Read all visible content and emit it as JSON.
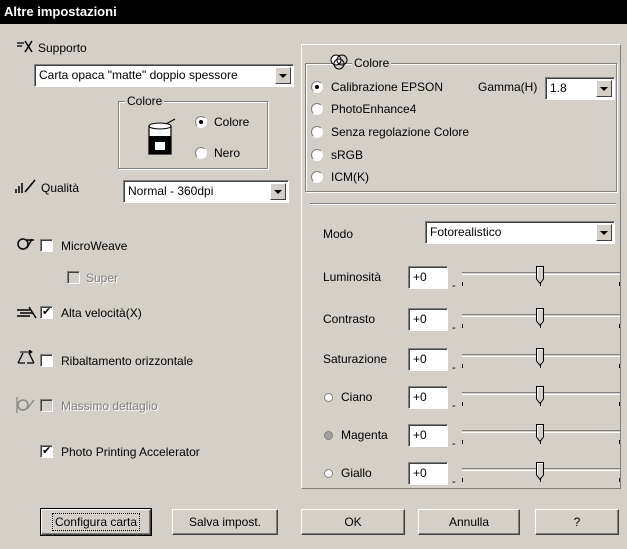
{
  "window": {
    "title": "Altre impostazioni"
  },
  "supporto": {
    "label": "Supporto",
    "value": "Carta opaca \"matte\" doppio spessore"
  },
  "colore_group": {
    "title": "Colore",
    "options": [
      {
        "label": "Colore",
        "selected": true
      },
      {
        "label": "Nero",
        "selected": false
      }
    ]
  },
  "qualita": {
    "label": "Qualità",
    "value": "Normal - 360dpi"
  },
  "checks": {
    "microweave": {
      "label": "MicroWeave",
      "checked": false
    },
    "super": {
      "label": "Super",
      "checked": false,
      "disabled": true
    },
    "alta_velocita": {
      "label": "Alta velocità(X)",
      "checked": true
    },
    "ribaltamento": {
      "label": "Ribaltamento orizzontale",
      "checked": false
    },
    "massimo": {
      "label": "Massimo dettaglio",
      "checked": false,
      "disabled": true
    },
    "photo_printing": {
      "label": "Photo Printing Accelerator",
      "checked": true
    }
  },
  "color_panel": {
    "title": "Colore",
    "options": [
      {
        "label": "Calibrazione EPSON",
        "selected": true
      },
      {
        "label": "PhotoEnhance4",
        "selected": false
      },
      {
        "label": "Senza regolazione Colore",
        "selected": false
      },
      {
        "label": "sRGB",
        "selected": false
      },
      {
        "label": "ICM(K)",
        "selected": false
      }
    ],
    "gamma": {
      "label": "Gamma(H)",
      "value": "1.8"
    }
  },
  "modo": {
    "label": "Modo",
    "value": "Fotorealistico"
  },
  "sliders": [
    {
      "label": "Luminosità",
      "value": "+0",
      "dot_color": ""
    },
    {
      "label": "Contrasto",
      "value": "+0",
      "dot_color": ""
    },
    {
      "label": "Saturazione",
      "value": "+0",
      "dot_color": ""
    },
    {
      "label": "Ciano",
      "value": "+0",
      "dot_color": "#ffffff"
    },
    {
      "label": "Magenta",
      "value": "+0",
      "dot_color": "#a0a0a0"
    },
    {
      "label": "Giallo",
      "value": "+0",
      "dot_color": "#ffffff"
    }
  ],
  "slider_ends": {
    "minus": "-",
    "plus": "+"
  },
  "buttons": {
    "configura": "Configura carta",
    "salva": "Salva impost.",
    "ok": "OK",
    "annulla": "Annulla",
    "help": "?"
  }
}
